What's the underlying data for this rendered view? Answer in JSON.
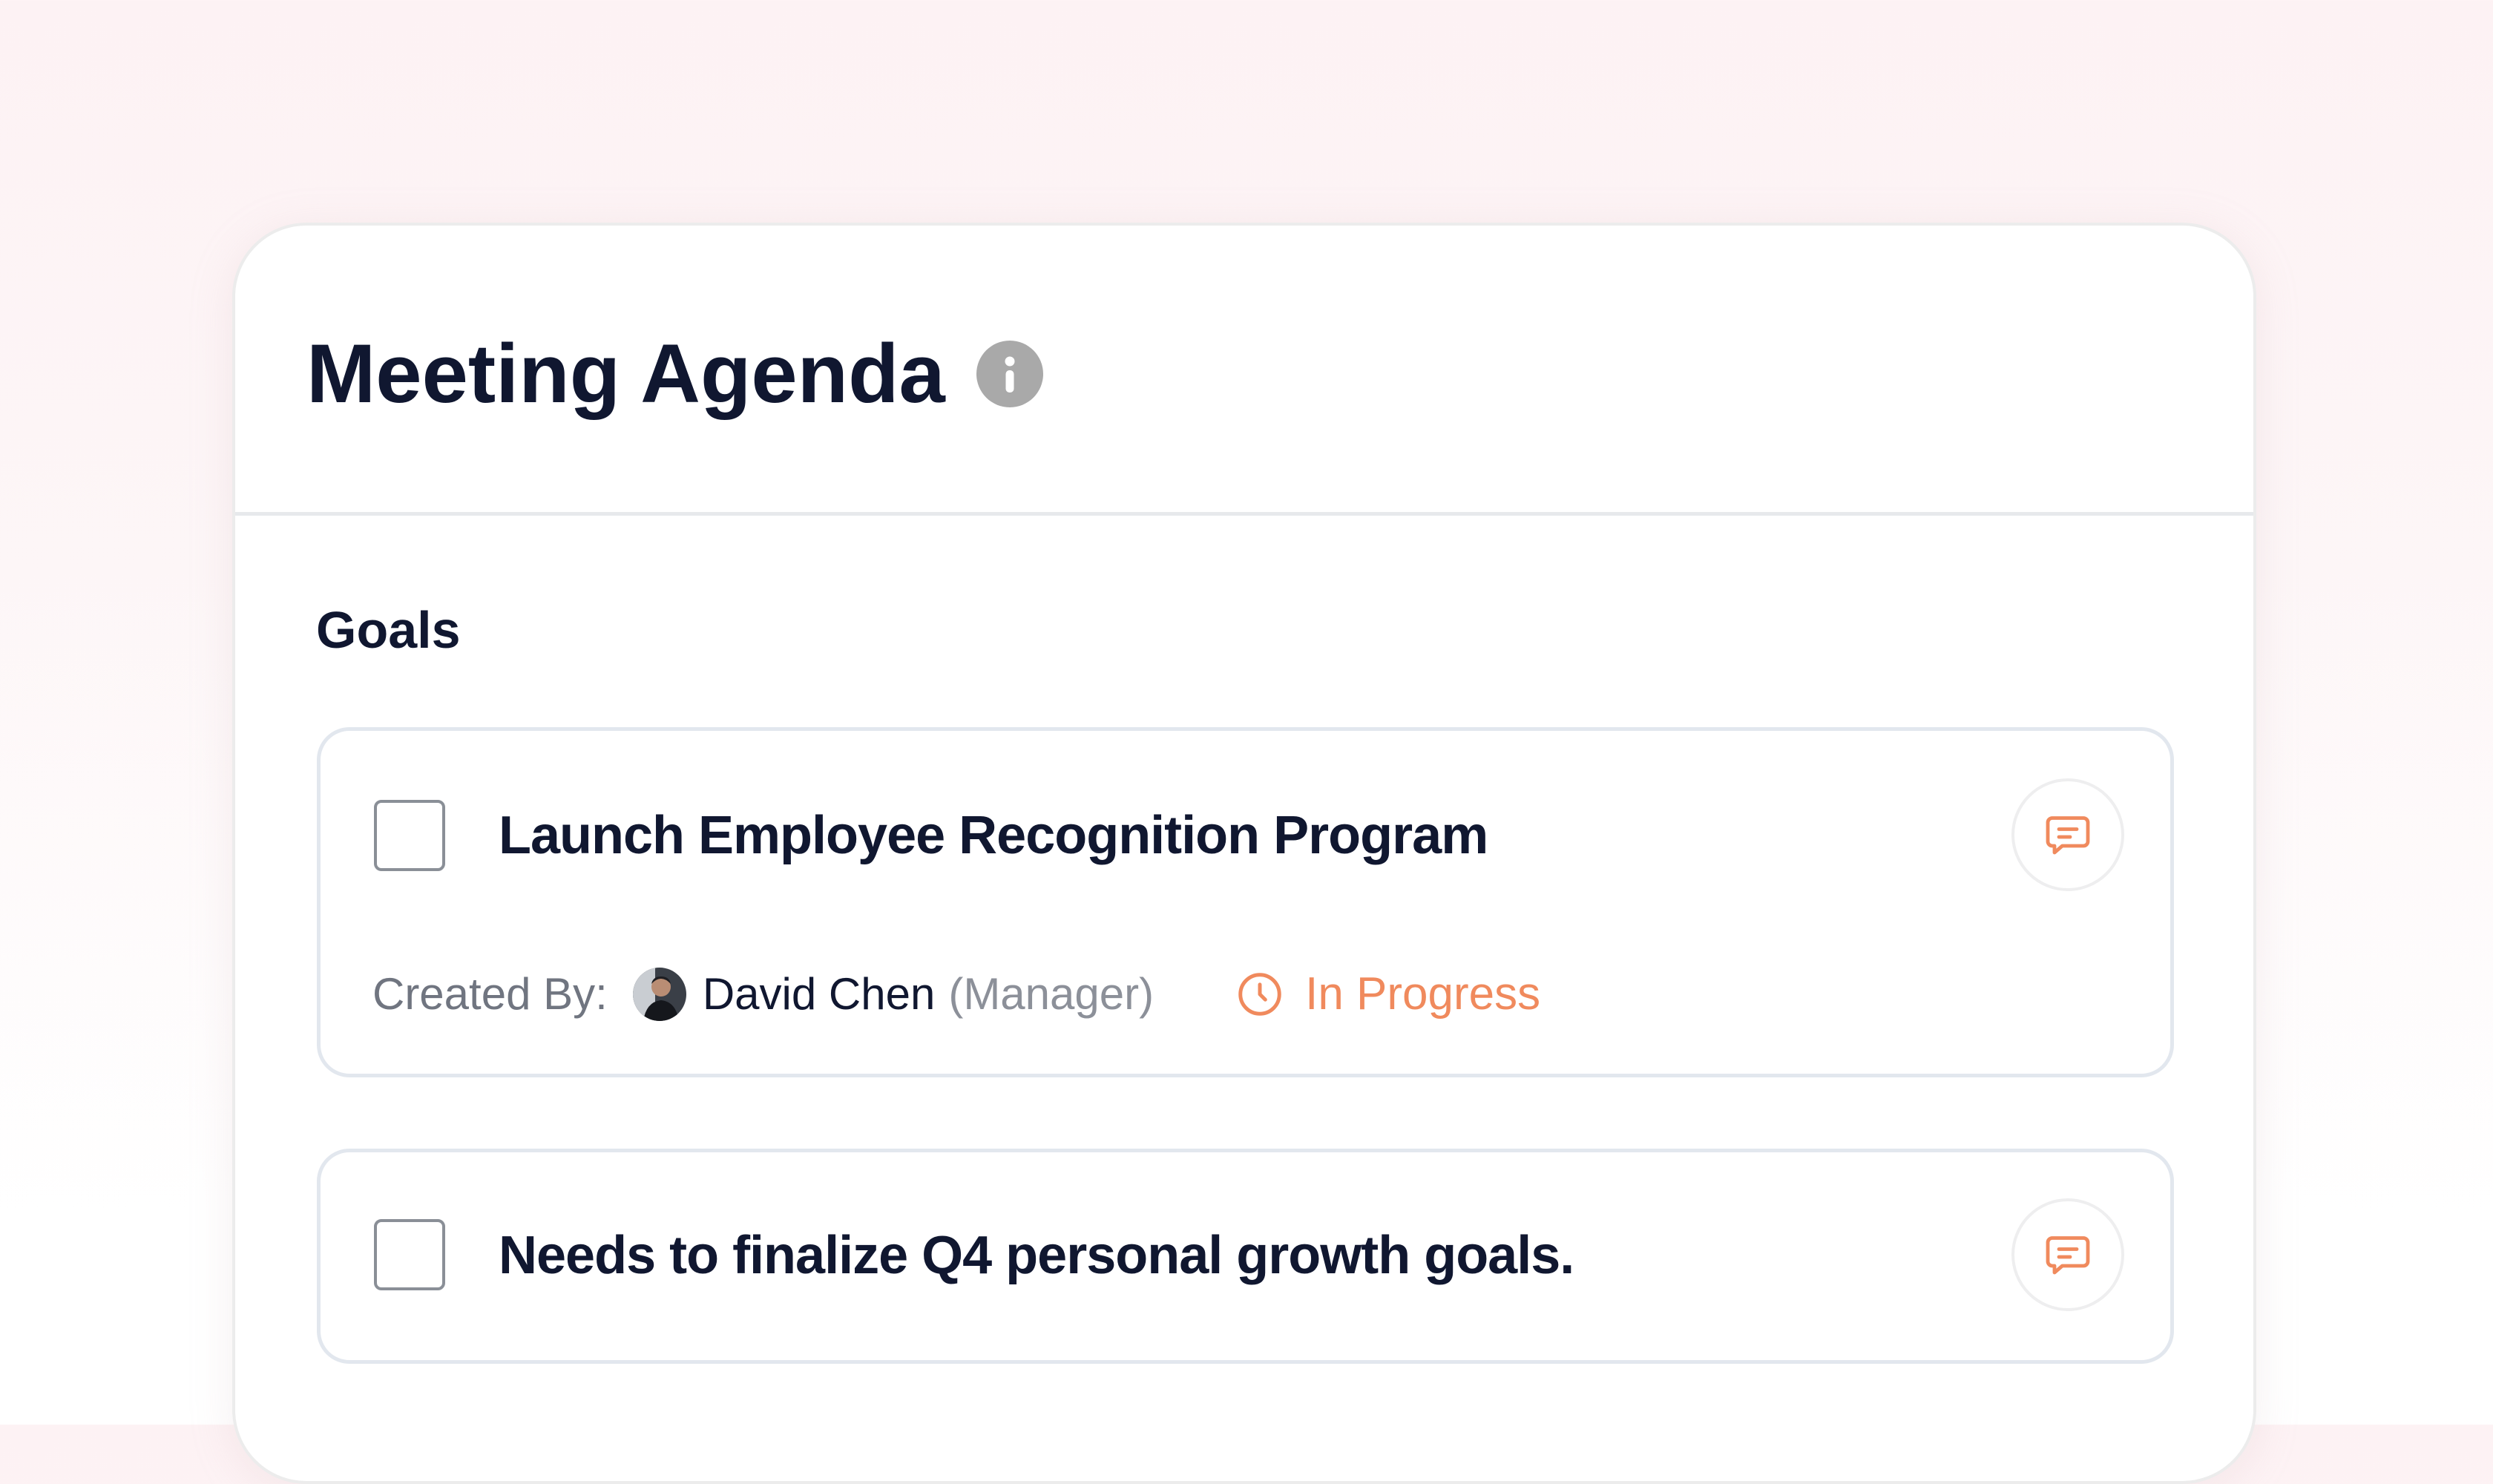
{
  "header": {
    "title": "Meeting Agenda",
    "info_icon": "info-icon"
  },
  "section": {
    "title": "Goals"
  },
  "goals": [
    {
      "title": "Launch Employee Recognition Program",
      "checked": false,
      "created_by_label": "Created By:",
      "creator_name": "David Chen",
      "creator_role": "(Manager)",
      "status": "In Progress",
      "status_icon": "clock-icon",
      "comment_icon": "comment-icon"
    },
    {
      "title": "Needs to finalize Q4 personal growth goals.",
      "checked": false,
      "comment_icon": "comment-icon"
    }
  ],
  "colors": {
    "accent": "#f08a5d",
    "text_primary": "#101730",
    "text_secondary": "#707580",
    "border": "#e2e7ee"
  }
}
